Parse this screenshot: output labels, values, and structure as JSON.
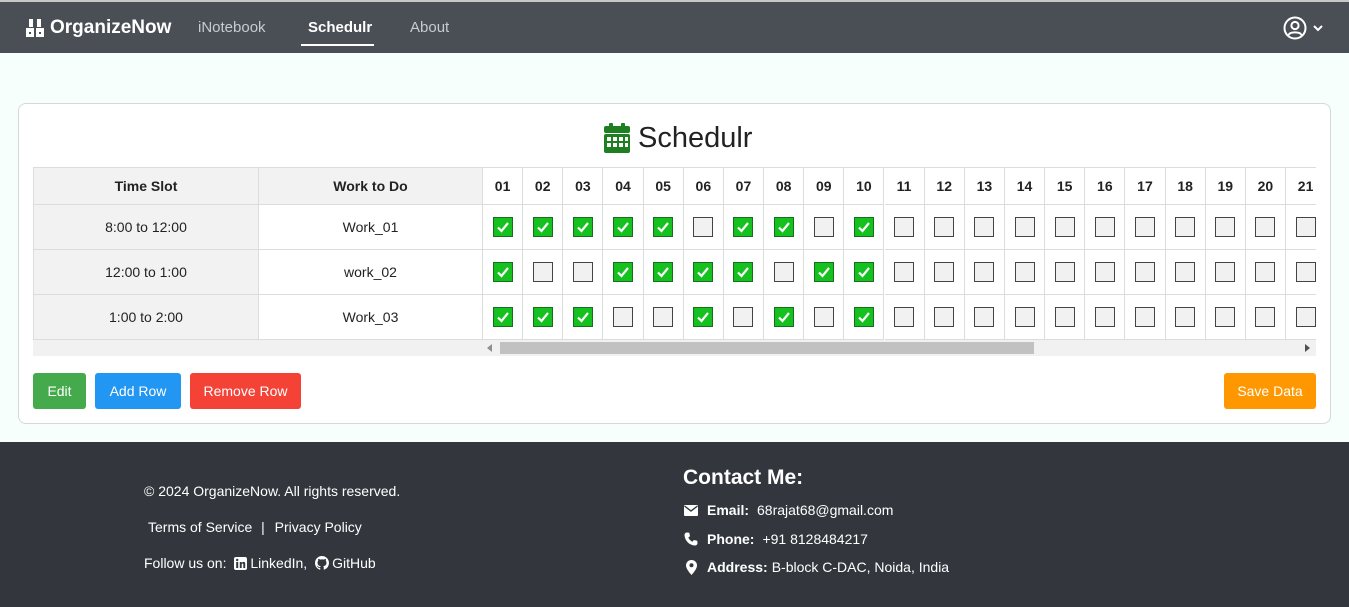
{
  "navbar": {
    "brand": "OrganizeNow",
    "links": [
      "iNotebook",
      "Schedulr",
      "About"
    ],
    "active_link": "Schedulr",
    "user_icon": "user-circle-icon",
    "dropdown_icon": "chevron-down-icon"
  },
  "page": {
    "title": "Schedulr",
    "title_icon": "calendar-icon",
    "title_icon_color": "#1e7e22"
  },
  "table": {
    "headers": {
      "time_slot": "Time Slot",
      "work": "Work to Do",
      "days": [
        "01",
        "02",
        "03",
        "04",
        "05",
        "06",
        "07",
        "08",
        "09",
        "10",
        "11",
        "12",
        "13",
        "14",
        "15",
        "16",
        "17",
        "18",
        "19",
        "20",
        "21"
      ]
    },
    "rows": [
      {
        "time": "8:00 to 12:00",
        "work": "Work_01",
        "checks": [
          1,
          1,
          1,
          1,
          1,
          0,
          1,
          1,
          0,
          1,
          0,
          0,
          0,
          0,
          0,
          0,
          0,
          0,
          0,
          0,
          0
        ]
      },
      {
        "time": "12:00 to 1:00",
        "work": "work_02",
        "checks": [
          1,
          0,
          0,
          1,
          1,
          1,
          1,
          0,
          1,
          1,
          0,
          0,
          0,
          0,
          0,
          0,
          0,
          0,
          0,
          0,
          0
        ]
      },
      {
        "time": "1:00 to 2:00",
        "work": "Work_03",
        "checks": [
          1,
          1,
          1,
          0,
          0,
          1,
          0,
          1,
          0,
          1,
          0,
          0,
          0,
          0,
          0,
          0,
          0,
          0,
          0,
          0,
          0
        ]
      }
    ],
    "checked_color": "#14c11f"
  },
  "buttons": {
    "edit": "Edit",
    "add_row": "Add Row",
    "remove_row": "Remove Row",
    "save": "Save Data"
  },
  "colors": {
    "navbar_bg": "#4a4f56",
    "footer_bg": "#33373d",
    "edit": "#44aa4c",
    "add": "#2196f3",
    "remove": "#f44336",
    "save": "#ff9800"
  },
  "footer": {
    "copyright": "© 2024 OrganizeNow. All rights reserved.",
    "terms": "Terms of Service",
    "separator": "|",
    "privacy": "Privacy Policy",
    "follow_label": "Follow us on:",
    "linkedin": "LinkedIn,",
    "github": "GitHub",
    "contact_title": "Contact Me:",
    "email_label": "Email:",
    "email": "68rajat68@gmail.com",
    "phone_label": "Phone:",
    "phone": "+91 8128484217",
    "address_label": "Address:",
    "address": "B-block C-DAC, Noida, India"
  }
}
